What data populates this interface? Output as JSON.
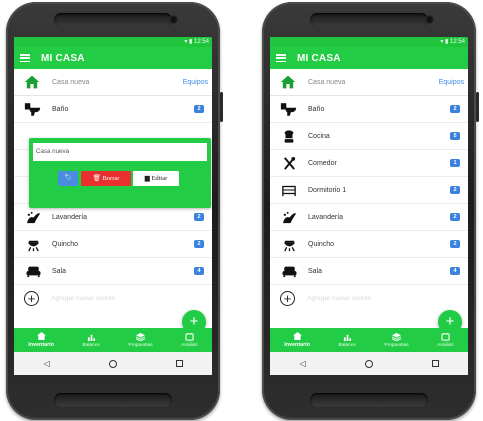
{
  "status_time": "12:54",
  "app": {
    "title": "MI CASA"
  },
  "house": {
    "name": "Casa nueva",
    "equipos_label": "Equipos"
  },
  "left_rooms": [
    {
      "name": "Baño",
      "count": "2",
      "icon": "toilet-icon"
    },
    {
      "name": "",
      "count": "",
      "icon": ""
    },
    {
      "name": "",
      "count": "",
      "icon": ""
    },
    {
      "name": "",
      "count": "",
      "icon": ""
    },
    {
      "name": "Lavandería",
      "count": "2",
      "icon": "washer-icon"
    },
    {
      "name": "Quincho",
      "count": "2",
      "icon": "grill-icon"
    },
    {
      "name": "Sala",
      "count": "4",
      "icon": "sofa-icon"
    }
  ],
  "right_rooms": [
    {
      "name": "Baño",
      "count": "2",
      "icon": "toilet-icon"
    },
    {
      "name": "Cocina",
      "count": "5",
      "icon": "chef-icon"
    },
    {
      "name": "Comedor",
      "count": "1",
      "icon": "cutlery-icon"
    },
    {
      "name": "Dormitorio 1",
      "count": "2",
      "icon": "bed-icon"
    },
    {
      "name": "Lavandería",
      "count": "2",
      "icon": "washer-icon"
    },
    {
      "name": "Quincho",
      "count": "2",
      "icon": "grill-icon"
    },
    {
      "name": "Sala",
      "count": "4",
      "icon": "sofa-icon"
    }
  ],
  "add_room_placeholder": "Agregar nuevo recinto",
  "fab_label": "+",
  "edit_dialog": {
    "input_value": "Casa nueva",
    "label_button": "🏷",
    "delete_button": "Borrar",
    "edit_button": "Editar"
  },
  "bottom_nav": [
    {
      "label": "Inventario",
      "icon": "home-icon",
      "active": true
    },
    {
      "label": "Balance",
      "icon": "bar-chart-icon",
      "active": false
    },
    {
      "label": "Propuestas",
      "icon": "layers-icon",
      "active": false
    },
    {
      "label": "Análisis",
      "icon": "tablet-icon",
      "active": false
    }
  ],
  "colors": {
    "primary": "#22cc44",
    "badge": "#3b82e0",
    "delete": "#e8312f",
    "link": "#3a8ee6"
  }
}
